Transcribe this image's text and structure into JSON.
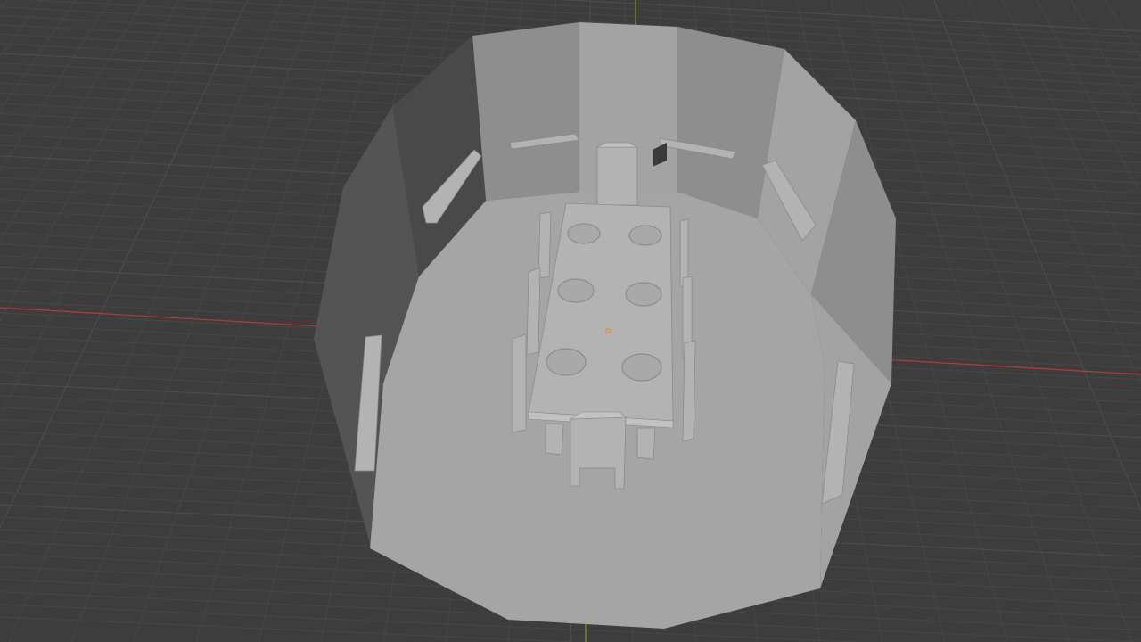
{
  "app": {
    "name": "3D viewport"
  },
  "viewport": {
    "background_color": "#3d3d3d",
    "grid_color_minor": "#474747",
    "grid_color_major": "#4f4f4f",
    "x_axis_color": "#b53a3a",
    "y_axis_color": "#7a9a2a",
    "origin_marker_color": "#e08a2a"
  },
  "scene": {
    "wall_color_light": "#a3a3a3",
    "wall_color_mid": "#8e8e8e",
    "wall_color_dark": "#555454",
    "floor_color": "#a5a5a5",
    "furniture_color": "#b3b3b3",
    "furniture_edge_color": "#8a8a8a",
    "objects": [
      "room-walls",
      "room-floor",
      "dining-table",
      "chairs",
      "plates",
      "wall-shelves"
    ]
  }
}
